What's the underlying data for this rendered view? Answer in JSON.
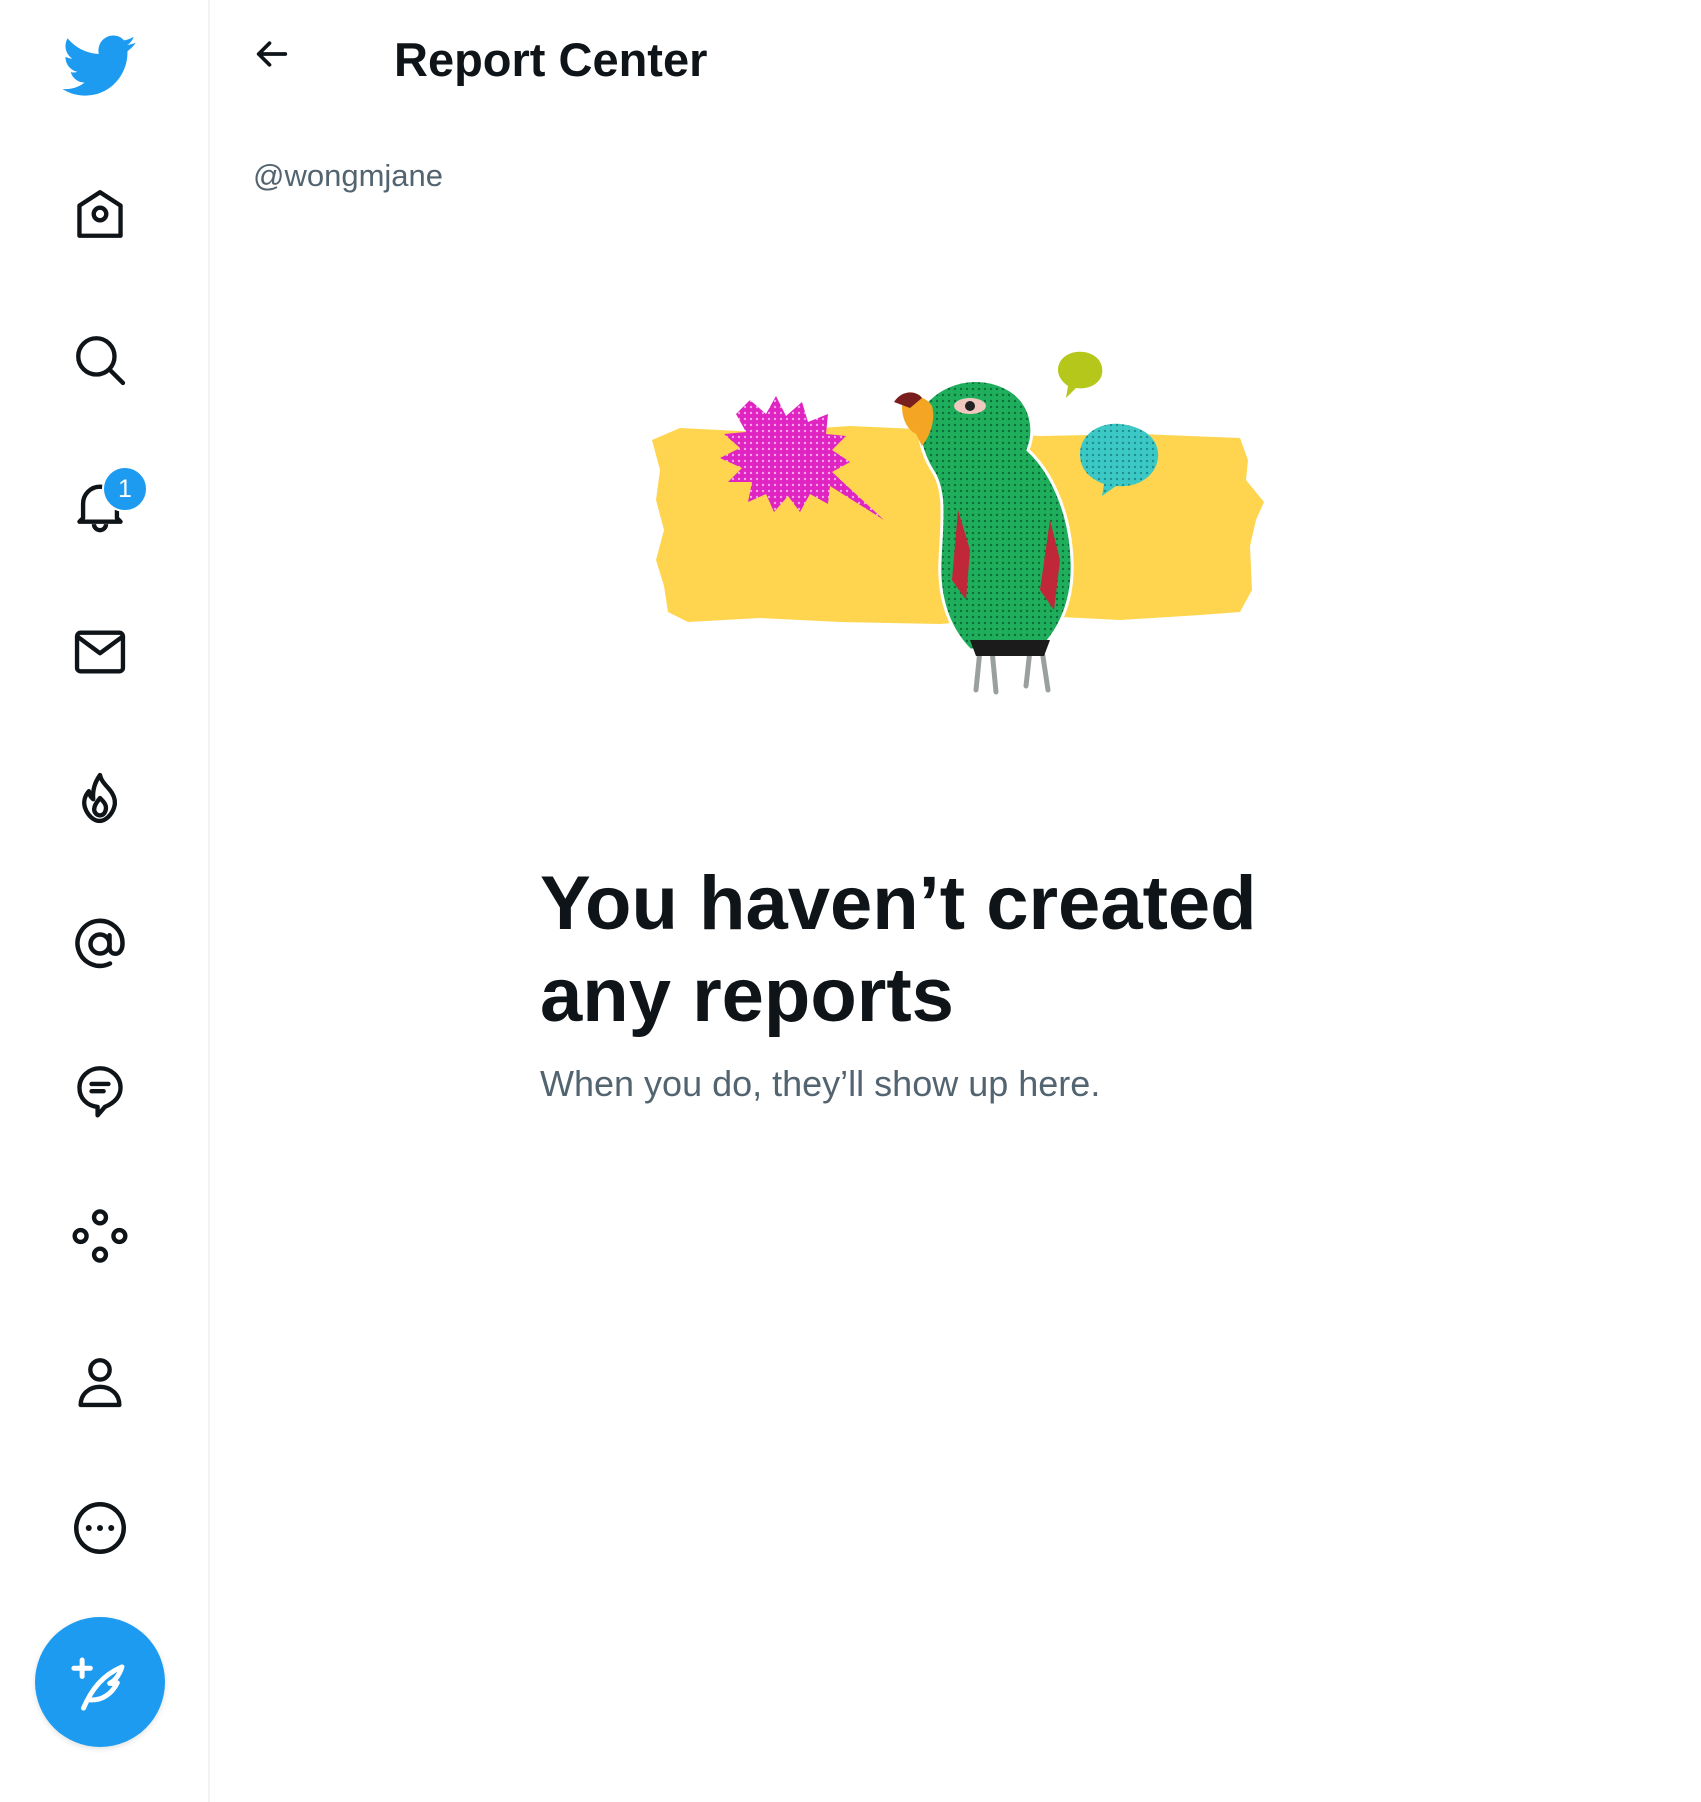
{
  "colors": {
    "brand_blue": "#1d9bf0",
    "text_primary": "#0f1419",
    "text_secondary": "#536471",
    "divider": "#eff3f4",
    "illustration_yellow": "#ffd550",
    "illustration_magenta": "#e024c2",
    "illustration_green": "#1fae5b",
    "illustration_teal": "#3cc9c6"
  },
  "sidebar": {
    "logo_icon": "twitter-bird-icon",
    "items": [
      {
        "id": "home",
        "icon": "home-icon"
      },
      {
        "id": "explore",
        "icon": "search-icon"
      },
      {
        "id": "notifications",
        "icon": "bell-icon",
        "badge": "1"
      },
      {
        "id": "messages",
        "icon": "mail-icon"
      },
      {
        "id": "trending",
        "icon": "flame-icon"
      },
      {
        "id": "mentions",
        "icon": "at-sign-icon"
      },
      {
        "id": "topics",
        "icon": "chat-bubble-icon"
      },
      {
        "id": "communities",
        "icon": "circles-icon"
      },
      {
        "id": "profile",
        "icon": "person-icon"
      },
      {
        "id": "more",
        "icon": "more-circle-icon"
      }
    ],
    "compose_icon": "compose-feather-icon"
  },
  "header": {
    "back_icon": "arrow-left-icon",
    "title": "Report Center"
  },
  "account": {
    "handle": "@wongmjane"
  },
  "empty_state": {
    "illustration": "parrot-with-speech-bubbles-illustration",
    "title": "You haven’t created any reports",
    "subtitle": "When you do, they’ll show up here."
  }
}
